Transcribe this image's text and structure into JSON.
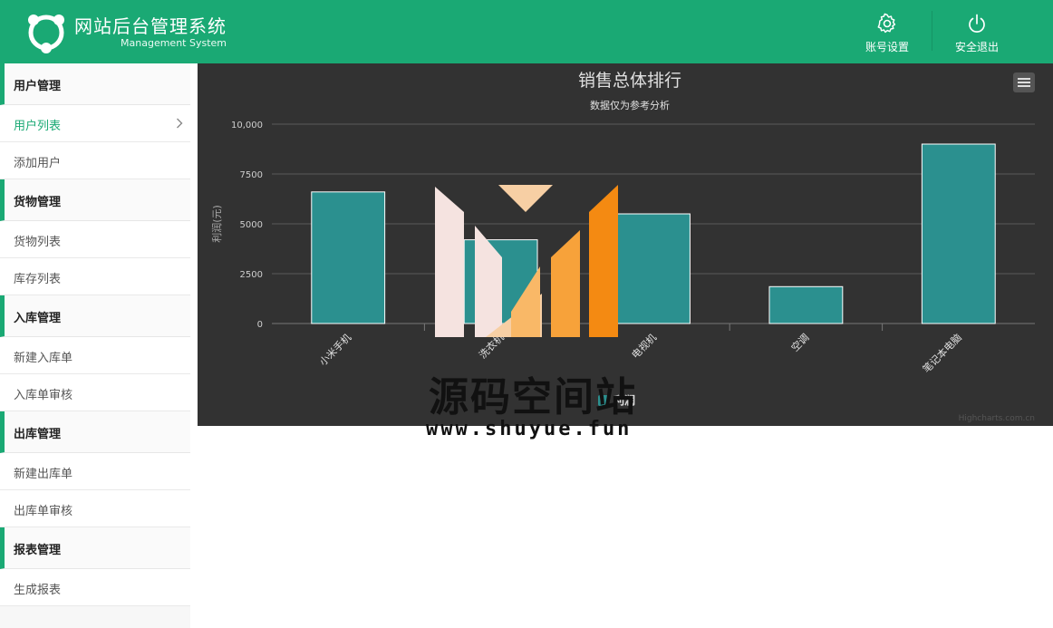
{
  "header": {
    "title": "网站后台管理系统",
    "subtitle": "Management System",
    "account_label": "账号设置",
    "logout_label": "安全退出"
  },
  "sidebar": {
    "groups": [
      {
        "title": "用户管理",
        "items": [
          {
            "label": "用户列表",
            "active": true
          },
          {
            "label": "添加用户"
          }
        ]
      },
      {
        "title": "货物管理",
        "items": [
          {
            "label": "货物列表"
          },
          {
            "label": "库存列表"
          }
        ]
      },
      {
        "title": "入库管理",
        "items": [
          {
            "label": "新建入库单"
          },
          {
            "label": "入库单审核"
          }
        ]
      },
      {
        "title": "出库管理",
        "items": [
          {
            "label": "新建出库单"
          },
          {
            "label": "出库单审核"
          }
        ]
      },
      {
        "title": "报表管理",
        "items": [
          {
            "label": "生成报表"
          }
        ]
      }
    ]
  },
  "chart_data": {
    "type": "bar",
    "title": "销售总体排行",
    "subtitle": "数据仅为参考分析",
    "ylabel": "利润(元)",
    "ylim": [
      0,
      10000
    ],
    "yticks": [
      "0",
      "2500",
      "5000",
      "7500",
      "10,000"
    ],
    "categories": [
      "小米手机",
      "洗衣机",
      "电视机",
      "空调",
      "笔记本电脑"
    ],
    "series": [
      {
        "name": "利润",
        "values": [
          6600,
          4200,
          5500,
          1850,
          9000
        ]
      }
    ],
    "credits": "Highcharts.com.cn",
    "bar_color": "#2b908f",
    "grid": true,
    "legend_position": "bottom"
  },
  "watermark": {
    "text": "源码空间站",
    "url": "www.shuyue.fun"
  },
  "colors": {
    "accent": "#1aa974",
    "chart_bg": "#323232"
  }
}
